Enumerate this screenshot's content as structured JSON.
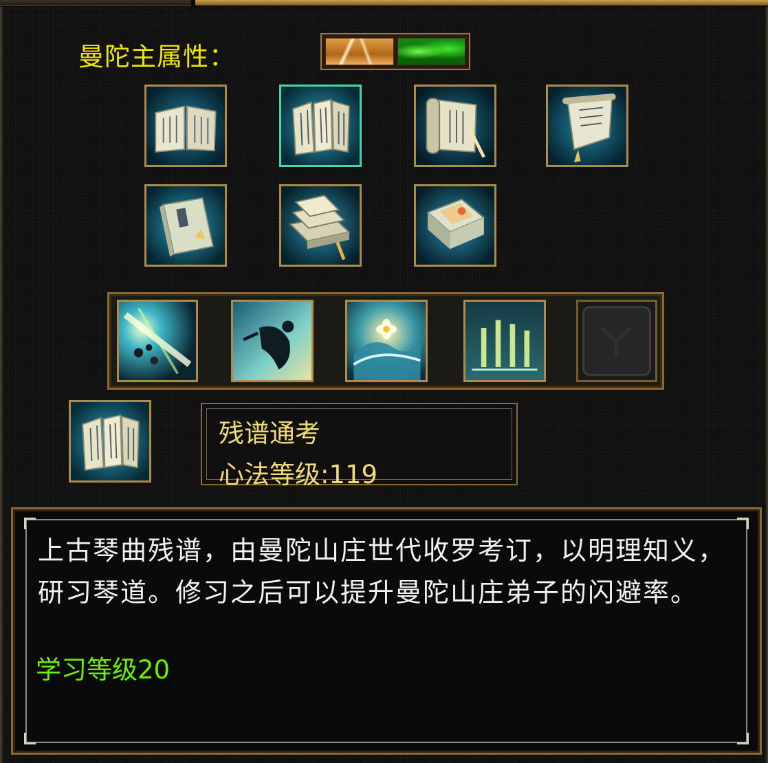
{
  "panel": {
    "attribute_label": "曼陀主属性：",
    "attribute_swatches": [
      {
        "name": "gold-attribute-swatch",
        "color": "#d08a34"
      },
      {
        "name": "green-attribute-swatch",
        "color": "#2ad41c"
      }
    ]
  },
  "manual_grid": [
    {
      "name": "open-book-icon",
      "selected": false
    },
    {
      "name": "folded-booklet-icon",
      "selected": true
    },
    {
      "name": "scroll-with-brush-icon",
      "selected": false
    },
    {
      "name": "hanging-scroll-icon",
      "selected": false
    },
    {
      "name": "closed-book-icon",
      "selected": false
    },
    {
      "name": "stacked-books-icon",
      "selected": false
    },
    {
      "name": "painted-case-icon",
      "selected": false
    }
  ],
  "skill_bar": [
    {
      "name": "strike-burst-skill-icon",
      "empty": false
    },
    {
      "name": "leaping-figure-skill-icon",
      "empty": false
    },
    {
      "name": "lotus-wave-skill-icon",
      "empty": false
    },
    {
      "name": "light-pillars-skill-icon",
      "empty": false
    },
    {
      "name": "empty-skill-slot-icon",
      "empty": true
    }
  ],
  "selected_manual": {
    "icon": "folded-booklet-icon",
    "name": "残谱通考",
    "level_text": "心法等级:119"
  },
  "description": {
    "text": "上古琴曲残谱，由曼陀山庄世代收罗考订，以明理知义，研习琴道。修习之后可以提升曼陀山庄弟子的闪避率。",
    "requirement": "学习等级20"
  },
  "colors": {
    "title_yellow": "#f0e600",
    "info_gold": "#f3d978",
    "requirement_green": "#6cf000",
    "frame_bronze": "#b08a48"
  }
}
